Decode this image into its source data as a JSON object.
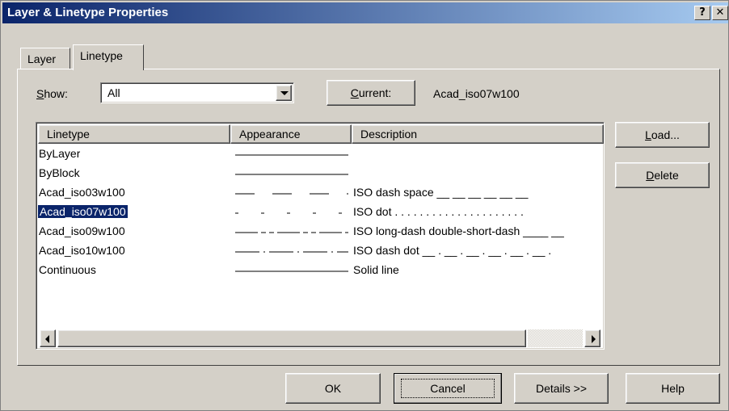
{
  "window": {
    "title": "Layer & Linetype Properties",
    "help_button": "?",
    "close_button": "✕"
  },
  "tabs": [
    {
      "label": "Layer",
      "active": false
    },
    {
      "label": "Linetype",
      "active": true
    }
  ],
  "show": {
    "label_prefix": "",
    "label_mnemonic": "S",
    "label_rest": "how:",
    "value": "All"
  },
  "current": {
    "button_mnemonic": "C",
    "button_rest": "urrent:",
    "value": "Acad_iso07w100"
  },
  "list": {
    "columns": [
      "Linetype",
      "Appearance",
      "Description"
    ],
    "rows": [
      {
        "name": "ByLayer",
        "appearance": "solid",
        "description": ""
      },
      {
        "name": "ByBlock",
        "appearance": "solid",
        "description": ""
      },
      {
        "name": "Acad_iso03w100",
        "appearance": "dash-space",
        "description": "ISO dash space __  __  __  __  __  __"
      },
      {
        "name": "Acad_iso07w100",
        "appearance": "dot",
        "description": "ISO dot . . . . . . . . . . . . . . . . . . . . .",
        "selected": true
      },
      {
        "name": "Acad_iso09w100",
        "appearance": "long-dash-double-short-dash",
        "description": "ISO long-dash double-short-dash ____ __"
      },
      {
        "name": "Acad_iso10w100",
        "appearance": "dash-dot",
        "description": "ISO dash dot __ . __ . __ . __ . __ . __ ."
      },
      {
        "name": "Continuous",
        "appearance": "solid",
        "description": "Solid line"
      }
    ]
  },
  "side_buttons": {
    "load_mnemonic": "L",
    "load_rest": "oad...",
    "delete_mnemonic": "D",
    "delete_rest": "elete"
  },
  "footer_buttons": {
    "ok": "OK",
    "cancel": "Cancel",
    "details": "Details >>",
    "help": "Help"
  },
  "colors": {
    "face": "#d4d0c8",
    "selection": "#0a246a",
    "title_start": "#0a246a",
    "title_end": "#a6caf0"
  }
}
